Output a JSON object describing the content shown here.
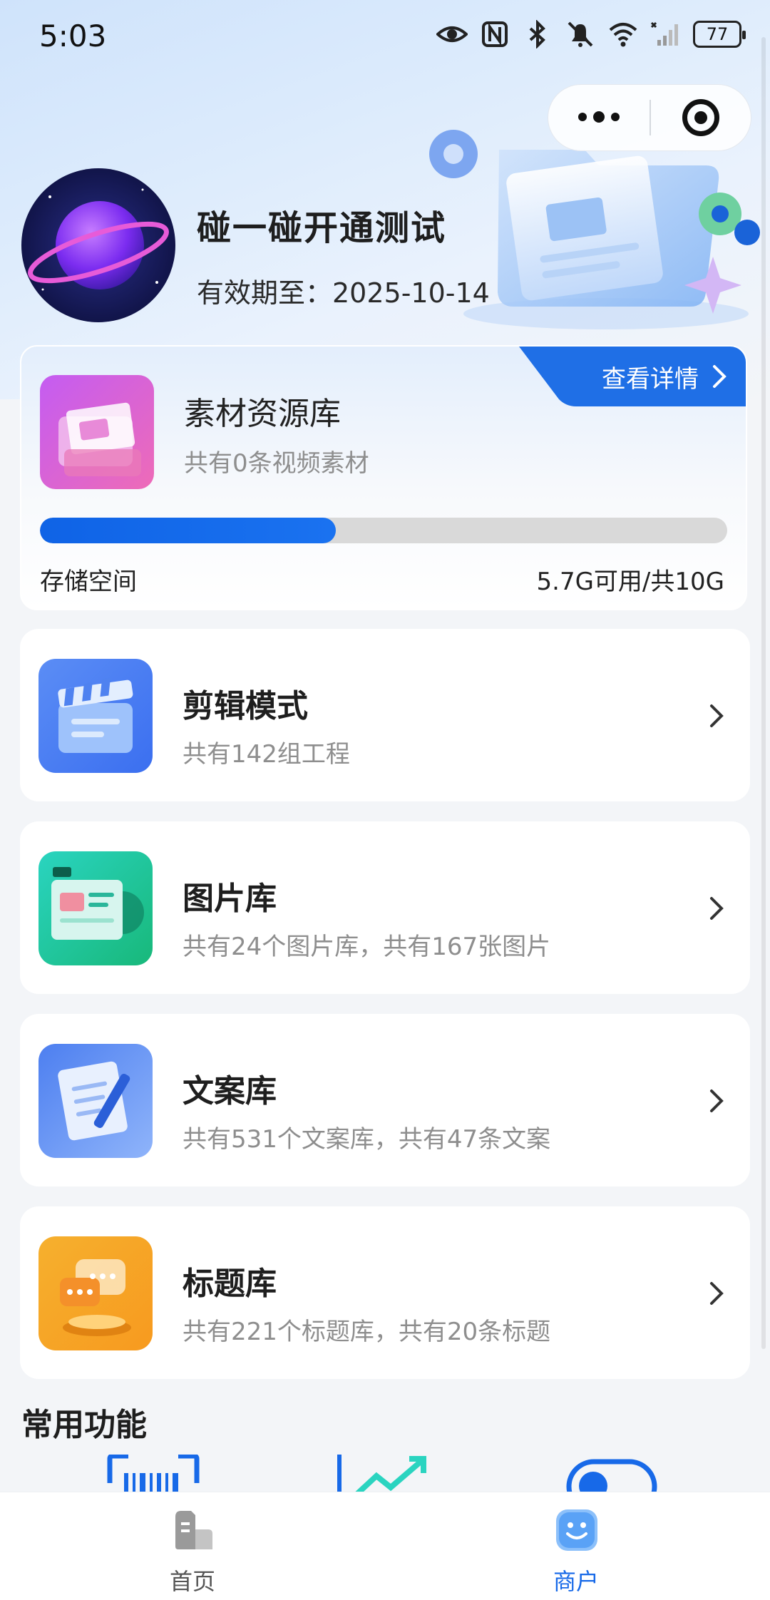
{
  "status_bar": {
    "time": "5:03",
    "battery": "77"
  },
  "capsule": {
    "more_icon": "more-dots-icon",
    "close_icon": "target-close-icon"
  },
  "profile": {
    "name": "碰一碰开通测试",
    "expiry": "有效期至：2025-10-14"
  },
  "material": {
    "title": "素材资源库",
    "subtitle": "共有0条视频素材",
    "view_detail": "查看详情",
    "storage_label": "存储空间",
    "storage_value": "5.7G可用/共10G",
    "storage_used_fraction": 0.43
  },
  "cards": [
    {
      "title": "剪辑模式",
      "subtitle": "共有142组工程",
      "icon": "clapperboard-icon"
    },
    {
      "title": "图片库",
      "subtitle": "共有24个图片库，共有167张图片",
      "icon": "image-gallery-icon"
    },
    {
      "title": "文案库",
      "subtitle": "共有531个文案库，共有47条文案",
      "icon": "notepad-pen-icon"
    },
    {
      "title": "标题库",
      "subtitle": "共有221个标题库，共有20条标题",
      "icon": "chat-bubble-icon"
    }
  ],
  "common": {
    "title": "常用功能"
  },
  "tabbar": {
    "items": [
      {
        "label": "首页",
        "icon": "home-icon",
        "active": false
      },
      {
        "label": "商户",
        "icon": "merchant-icon",
        "active": true
      }
    ]
  },
  "colors": {
    "accent": "#1769e8",
    "active_tab": "#1769e8",
    "inactive_tab": "#555555"
  }
}
